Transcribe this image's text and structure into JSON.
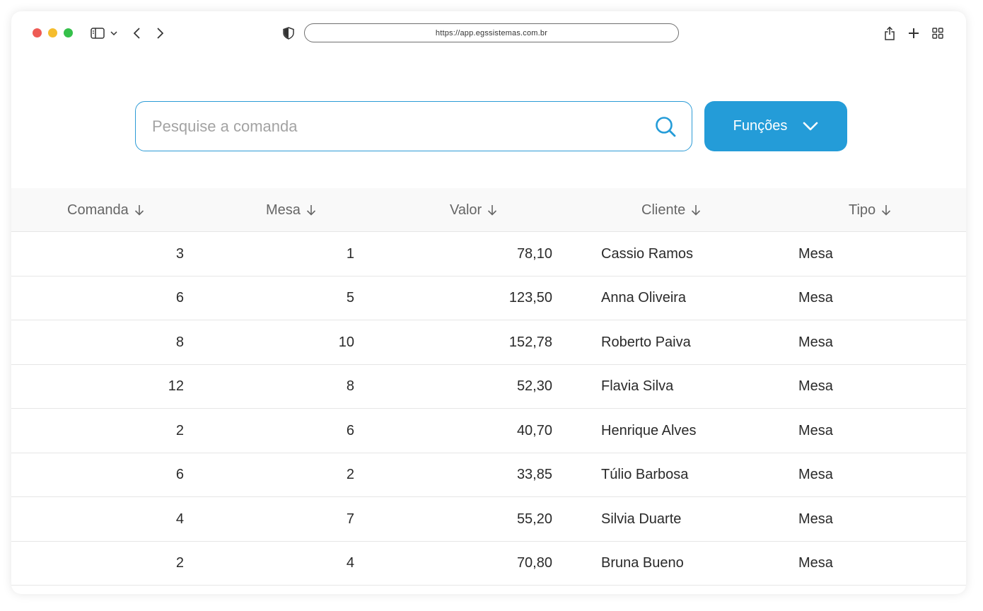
{
  "browser": {
    "url": "https://app.egssistemas.com.br"
  },
  "search": {
    "placeholder": "Pesquise a comanda",
    "value": ""
  },
  "functions_button": {
    "label": "Funções"
  },
  "colors": {
    "accent": "#249cd8",
    "header_bg": "#f9f9f9",
    "text": "#2a2a2a",
    "header_text": "#666666"
  },
  "table": {
    "columns": [
      "Comanda",
      "Mesa",
      "Valor",
      "Cliente",
      "Tipo"
    ],
    "rows": [
      {
        "comanda": "3",
        "mesa": "1",
        "valor": "78,10",
        "cliente": "Cassio Ramos",
        "tipo": "Mesa"
      },
      {
        "comanda": "6",
        "mesa": "5",
        "valor": "123,50",
        "cliente": "Anna Oliveira",
        "tipo": "Mesa"
      },
      {
        "comanda": "8",
        "mesa": "10",
        "valor": "152,78",
        "cliente": "Roberto Paiva",
        "tipo": "Mesa"
      },
      {
        "comanda": "12",
        "mesa": "8",
        "valor": "52,30",
        "cliente": "Flavia Silva",
        "tipo": "Mesa"
      },
      {
        "comanda": "2",
        "mesa": "6",
        "valor": "40,70",
        "cliente": "Henrique Alves",
        "tipo": "Mesa"
      },
      {
        "comanda": "6",
        "mesa": "2",
        "valor": "33,85",
        "cliente": "Túlio Barbosa",
        "tipo": "Mesa"
      },
      {
        "comanda": "4",
        "mesa": "7",
        "valor": "55,20",
        "cliente": "Silvia Duarte",
        "tipo": "Mesa"
      },
      {
        "comanda": "2",
        "mesa": "4",
        "valor": "70,80",
        "cliente": "Bruna Bueno",
        "tipo": "Mesa"
      }
    ]
  }
}
